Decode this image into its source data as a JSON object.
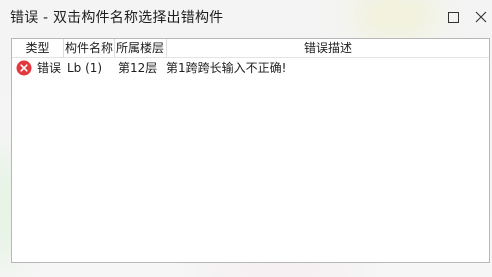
{
  "window": {
    "title": "错误 - 双击构件名称选择出错构件",
    "maximize_icon": "maximize-square-icon",
    "close_icon": "close-x-icon"
  },
  "table": {
    "columns": [
      "类型",
      "构件名称",
      "所属楼层",
      "错误描述"
    ],
    "rows": [
      {
        "icon": "error-circle-x-icon",
        "type": "错误",
        "name": "Lb (1)",
        "floor": "第12层",
        "description": "第1跨跨长输入不正确!"
      }
    ]
  },
  "colors": {
    "error_red": "#e0393e",
    "border": "#b7b7b7",
    "text": "#1e1e1e"
  }
}
